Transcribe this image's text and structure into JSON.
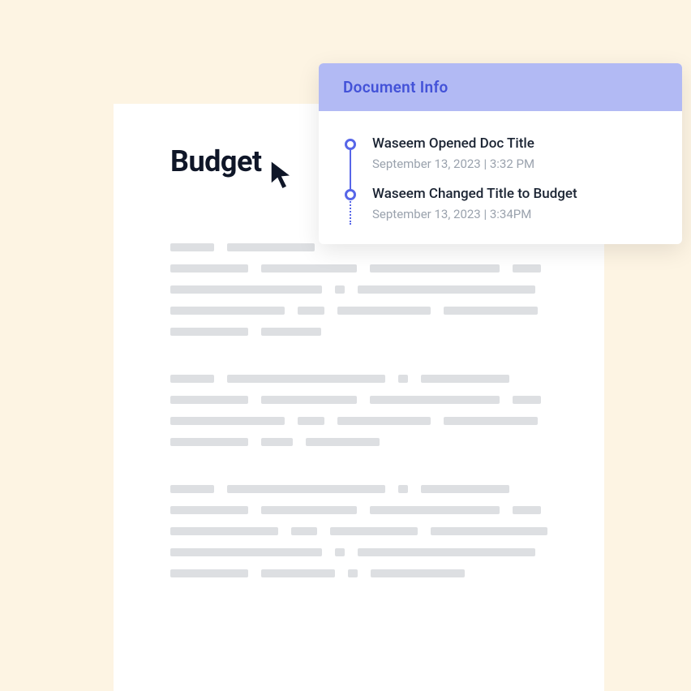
{
  "document": {
    "title": "Budget"
  },
  "info_panel": {
    "header": "Document Info",
    "events": [
      {
        "title": "Waseem Opened Doc Title",
        "meta": "September 13, 2023 | 3:32 PM"
      },
      {
        "title": "Waseem Changed Title to Budget",
        "meta": "September 13, 2023 | 3:34PM"
      }
    ]
  }
}
